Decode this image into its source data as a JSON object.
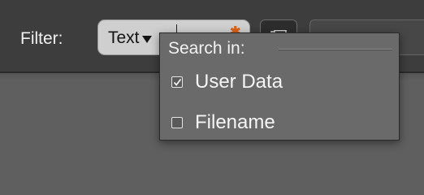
{
  "toolbar": {
    "filter_label": "Filter:",
    "filter_field": {
      "scope_label": "Text",
      "value": ""
    }
  },
  "menu": {
    "title": "Search in:",
    "items": [
      {
        "label": "User Data",
        "checked": true
      },
      {
        "label": "Filename",
        "checked": false
      }
    ]
  },
  "colors": {
    "toolbar_bg": "#3d3d3d",
    "content_bg": "#5f5f5f",
    "menu_bg": "#6a6a6a",
    "clear_icon": "#d8621a"
  },
  "icons": [
    "chevron-down-icon",
    "clear-icon",
    "options-icon",
    "checkmark-icon"
  ]
}
